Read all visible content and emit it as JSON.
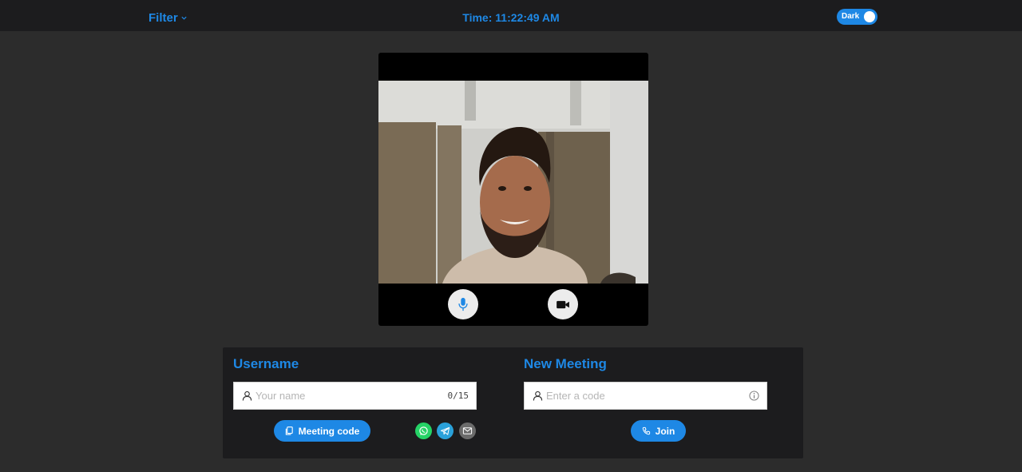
{
  "header": {
    "filter_label": "Filter",
    "time_prefix": "Time:",
    "time_value": "11:22:49 AM",
    "theme_toggle_label": "Dark"
  },
  "video": {
    "mic_icon": "microphone-icon",
    "camera_icon": "video-camera-icon"
  },
  "username_section": {
    "heading": "Username",
    "placeholder": "Your name",
    "value": "",
    "char_counter": "0/15",
    "meeting_code_label": "Meeting code",
    "share_icons": [
      "whatsapp-icon",
      "telegram-icon",
      "email-icon"
    ]
  },
  "meeting_section": {
    "heading": "New Meeting",
    "placeholder": "Enter a code",
    "value": "",
    "join_label": "Join"
  },
  "colors": {
    "accent": "#1e88e5",
    "background": "#2c2c2c",
    "panel": "#1c1c1e",
    "whatsapp": "#25d366",
    "telegram": "#2aa1da",
    "email": "#6b6b6b"
  }
}
